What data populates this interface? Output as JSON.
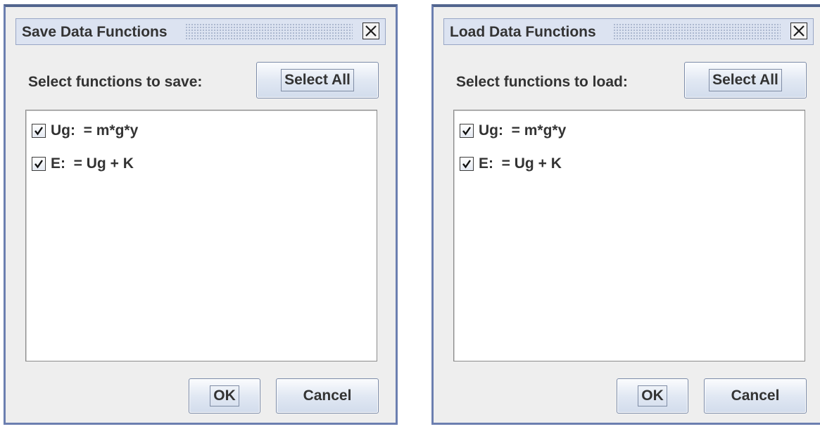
{
  "dialogs": [
    {
      "title": "Save Data Functions",
      "prompt": "Select functions to save:",
      "select_all_label": "Select All",
      "functions": [
        {
          "label": "Ug:  = m*g*y",
          "checked": true
        },
        {
          "label": "E:  = Ug + K",
          "checked": true
        }
      ],
      "ok_label": "OK",
      "cancel_label": "Cancel"
    },
    {
      "title": "Load Data Functions",
      "prompt": "Select functions to load:",
      "select_all_label": "Select All",
      "functions": [
        {
          "label": "Ug:  = m*g*y",
          "checked": true
        },
        {
          "label": "E:  = Ug + K",
          "checked": true
        }
      ],
      "ok_label": "OK",
      "cancel_label": "Cancel"
    }
  ],
  "colors": {
    "window_border": "#6c7fb0",
    "titlebar_bg": "#dce3f1",
    "dialog_bg": "#eeeeee",
    "text": "#333333"
  },
  "icons": {
    "close": "close-icon",
    "check": "checkmark-icon"
  }
}
